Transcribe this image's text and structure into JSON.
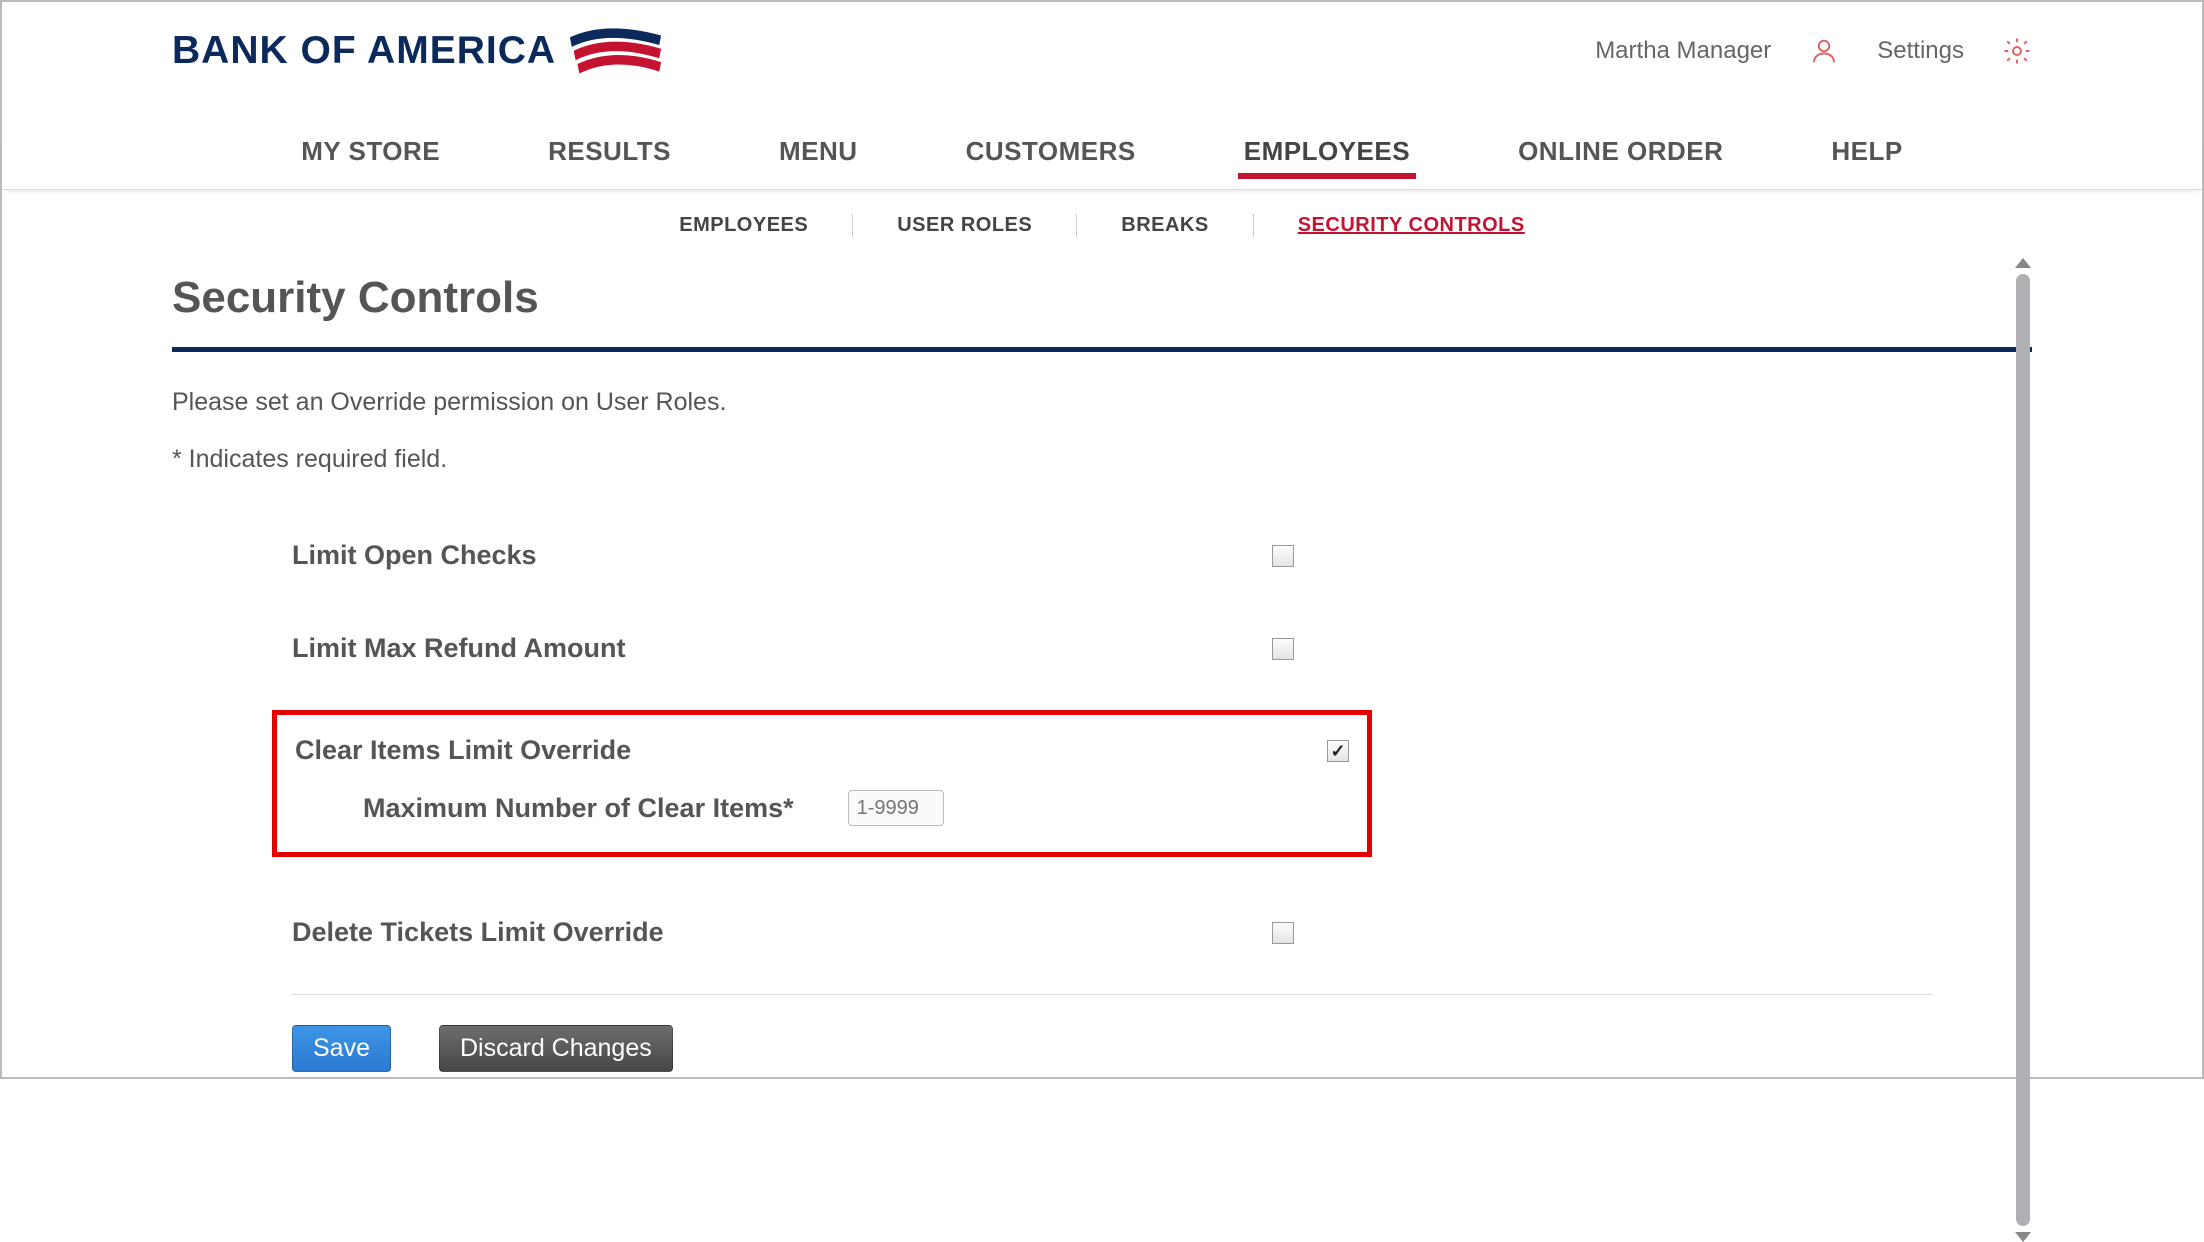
{
  "brand": {
    "name": "BANK OF AMERICA"
  },
  "header": {
    "user_name": "Martha Manager",
    "settings_label": "Settings"
  },
  "main_nav": {
    "items": [
      "MY STORE",
      "RESULTS",
      "MENU",
      "CUSTOMERS",
      "EMPLOYEES",
      "ONLINE ORDER",
      "HELP"
    ],
    "active_index": 4
  },
  "sub_nav": {
    "items": [
      "EMPLOYEES",
      "USER ROLES",
      "BREAKS",
      "SECURITY CONTROLS"
    ],
    "active_index": 3
  },
  "page": {
    "title": "Security Controls",
    "intro": "Please set an Override permission on User Roles.",
    "required_note": "* Indicates required field."
  },
  "rows": {
    "limit_open_checks": {
      "label": "Limit Open Checks",
      "checked": false
    },
    "limit_max_refund": {
      "label": "Limit Max Refund Amount",
      "checked": false
    },
    "clear_items_override": {
      "label": "Clear Items Limit Override",
      "checked": true,
      "sub_label": "Maximum Number of Clear Items*",
      "input_placeholder": "1-9999",
      "input_value": ""
    },
    "delete_tickets_override": {
      "label": "Delete Tickets Limit Override",
      "checked": false
    }
  },
  "buttons": {
    "save": "Save",
    "discard": "Discard Changes"
  }
}
